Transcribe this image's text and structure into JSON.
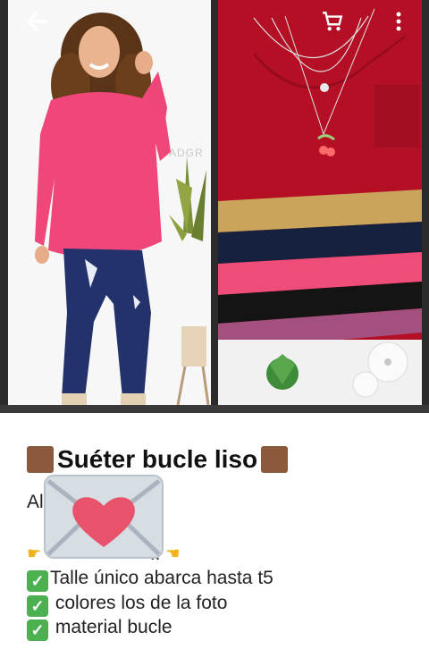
{
  "watermark": "ADGR",
  "icons": {
    "back": "arrow-left-icon",
    "cart": "shopping-cart-icon",
    "more": "more-vertical-icon",
    "sticker": "envelope-heart-icon",
    "title_square": "brown-square-icon",
    "check": "check-mark-icon",
    "pointing_hand": "pointing-hand-icon"
  },
  "colors": {
    "sweater_pink": "#f0467a",
    "sweater_red": "#b40f25",
    "check_green": "#4caf50",
    "title_square": "#8b5a3c"
  },
  "post": {
    "title": "Suéter bucle liso",
    "intro": "Al",
    "point_line": "!!",
    "check_mark": "✓",
    "features": [
      "Talle único abarca hasta t5",
      " colores los de la foto",
      " material bucle"
    ]
  }
}
